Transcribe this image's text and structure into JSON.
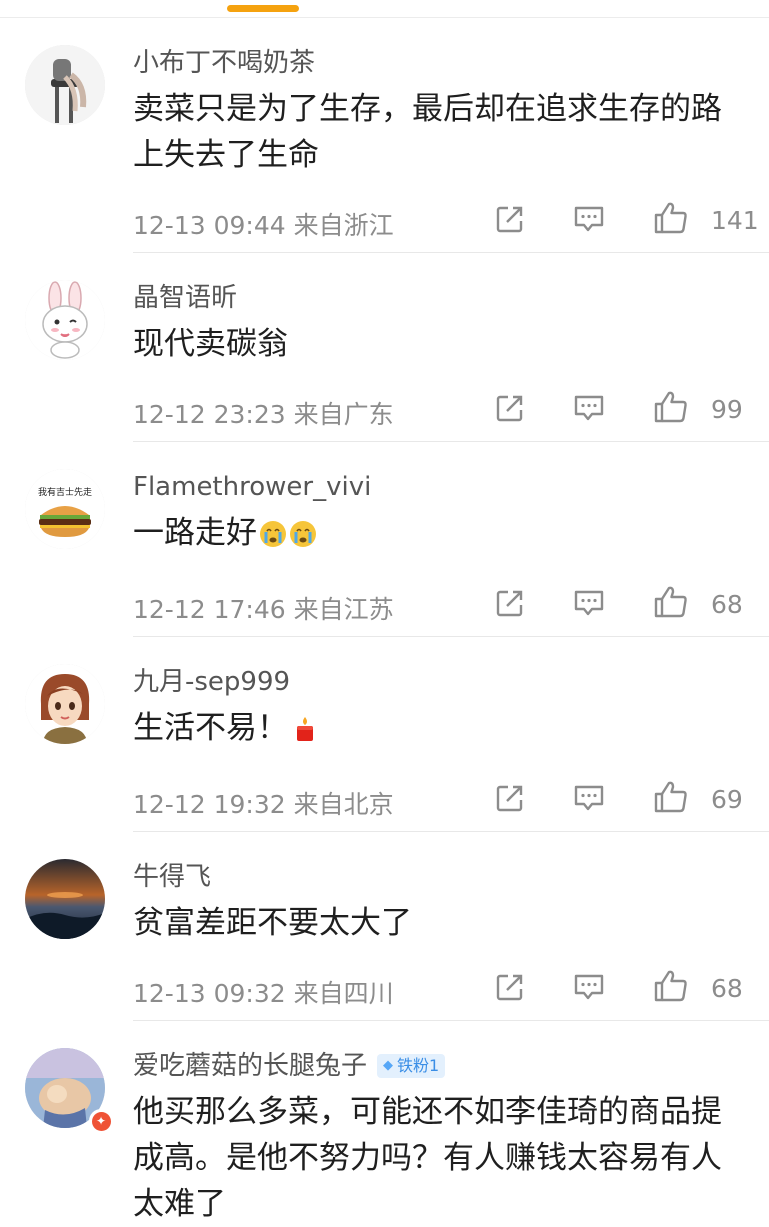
{
  "accent_color": "#f5a20f",
  "comments": [
    {
      "username": "小布丁不喝奶茶",
      "text": "卖菜只是为了生存，最后却在追求生存的路上失去了生命",
      "time": "12-13 09:44",
      "location": "来自浙江",
      "likes": "141"
    },
    {
      "username": "晶智语昕",
      "text": "现代卖碳翁",
      "time": "12-12 23:23",
      "location": "来自广东",
      "likes": "99"
    },
    {
      "username": "Flamethrower_vivi",
      "text": "一路走好",
      "time": "12-12 17:46",
      "location": "来自江苏",
      "likes": "68",
      "avatar_text": "我有吉士先走"
    },
    {
      "username": "九月-sep999",
      "text": "生活不易！",
      "time": "12-12 19:32",
      "location": "来自北京",
      "likes": "69"
    },
    {
      "username": "牛得飞",
      "text": "贫富差距不要太大了",
      "time": "12-13 09:32",
      "location": "来自四川",
      "likes": "68"
    },
    {
      "username": "爱吃蘑菇的长腿兔子",
      "badge": "铁粉1",
      "text": "他买那么多菜，可能还不如李佳琦的商品提成高。是他不努力吗？有人赚钱太容易有人太难了"
    }
  ]
}
